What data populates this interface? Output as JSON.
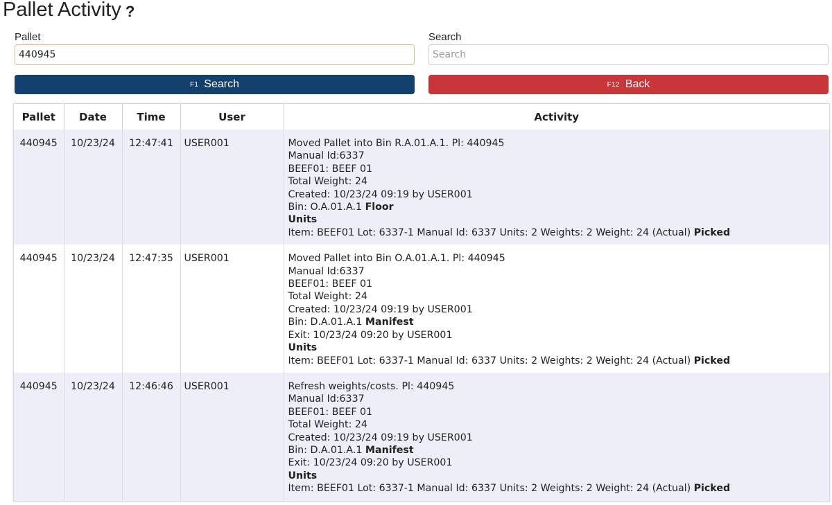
{
  "page": {
    "title": "Pallet Activity",
    "help_glyph": "?"
  },
  "form": {
    "pallet_label": "Pallet",
    "pallet_value": "440945",
    "search_label": "Search",
    "search_placeholder": "Search",
    "search_value": ""
  },
  "buttons": {
    "search": {
      "key": "F1",
      "label": "Search",
      "color": "#14406e"
    },
    "back": {
      "key": "F12",
      "label": "Back",
      "color": "#c9363a"
    }
  },
  "table": {
    "headers": {
      "pallet": "Pallet",
      "date": "Date",
      "time": "Time",
      "user": "User",
      "activity": "Activity"
    },
    "rows": [
      {
        "pallet": "440945",
        "date": "10/23/24",
        "time": "12:47:41",
        "user": "USER001",
        "lines": [
          {
            "text": "Moved Pallet into Bin R.A.01.A.1. Pl: 440945"
          },
          {
            "text": "Manual Id:6337"
          },
          {
            "text": "BEEF01: BEEF 01"
          },
          {
            "text": "Total Weight: 24"
          },
          {
            "text": "Created: 10/23/24 09:19 by USER001"
          },
          {
            "text": "Bin: O.A.01.A.1 ",
            "bold": "Floor"
          },
          {
            "text": "",
            "bold": "Units"
          },
          {
            "text": "Item: BEEF01 Lot: 6337-1 Manual Id: 6337 Units: 2 Weights: 2 Weight: 24 (Actual) ",
            "bold": "Picked"
          }
        ]
      },
      {
        "pallet": "440945",
        "date": "10/23/24",
        "time": "12:47:35",
        "user": "USER001",
        "lines": [
          {
            "text": "Moved Pallet into Bin O.A.01.A.1. Pl: 440945"
          },
          {
            "text": "Manual Id:6337"
          },
          {
            "text": "BEEF01: BEEF 01"
          },
          {
            "text": "Total Weight: 24"
          },
          {
            "text": "Created: 10/23/24 09:19 by USER001"
          },
          {
            "text": "Bin: D.A.01.A.1 ",
            "bold": "Manifest"
          },
          {
            "text": "Exit: 10/23/24 09:20 by USER001"
          },
          {
            "text": "",
            "bold": "Units"
          },
          {
            "text": "Item: BEEF01 Lot: 6337-1 Manual Id: 6337 Units: 2 Weights: 2 Weight: 24 (Actual) ",
            "bold": "Picked"
          }
        ]
      },
      {
        "pallet": "440945",
        "date": "10/23/24",
        "time": "12:46:46",
        "user": "USER001",
        "lines": [
          {
            "text": "Refresh weights/costs. Pl: 440945"
          },
          {
            "text": "Manual Id:6337"
          },
          {
            "text": "BEEF01: BEEF 01"
          },
          {
            "text": "Total Weight: 24"
          },
          {
            "text": "Created: 10/23/24 09:19 by USER001"
          },
          {
            "text": "Bin: D.A.01.A.1 ",
            "bold": "Manifest"
          },
          {
            "text": "Exit: 10/23/24 09:20 by USER001"
          },
          {
            "text": "",
            "bold": "Units"
          },
          {
            "text": "Item: BEEF01 Lot: 6337-1 Manual Id: 6337 Units: 2 Weights: 2 Weight: 24 (Actual) ",
            "bold": "Picked"
          }
        ]
      }
    ]
  }
}
